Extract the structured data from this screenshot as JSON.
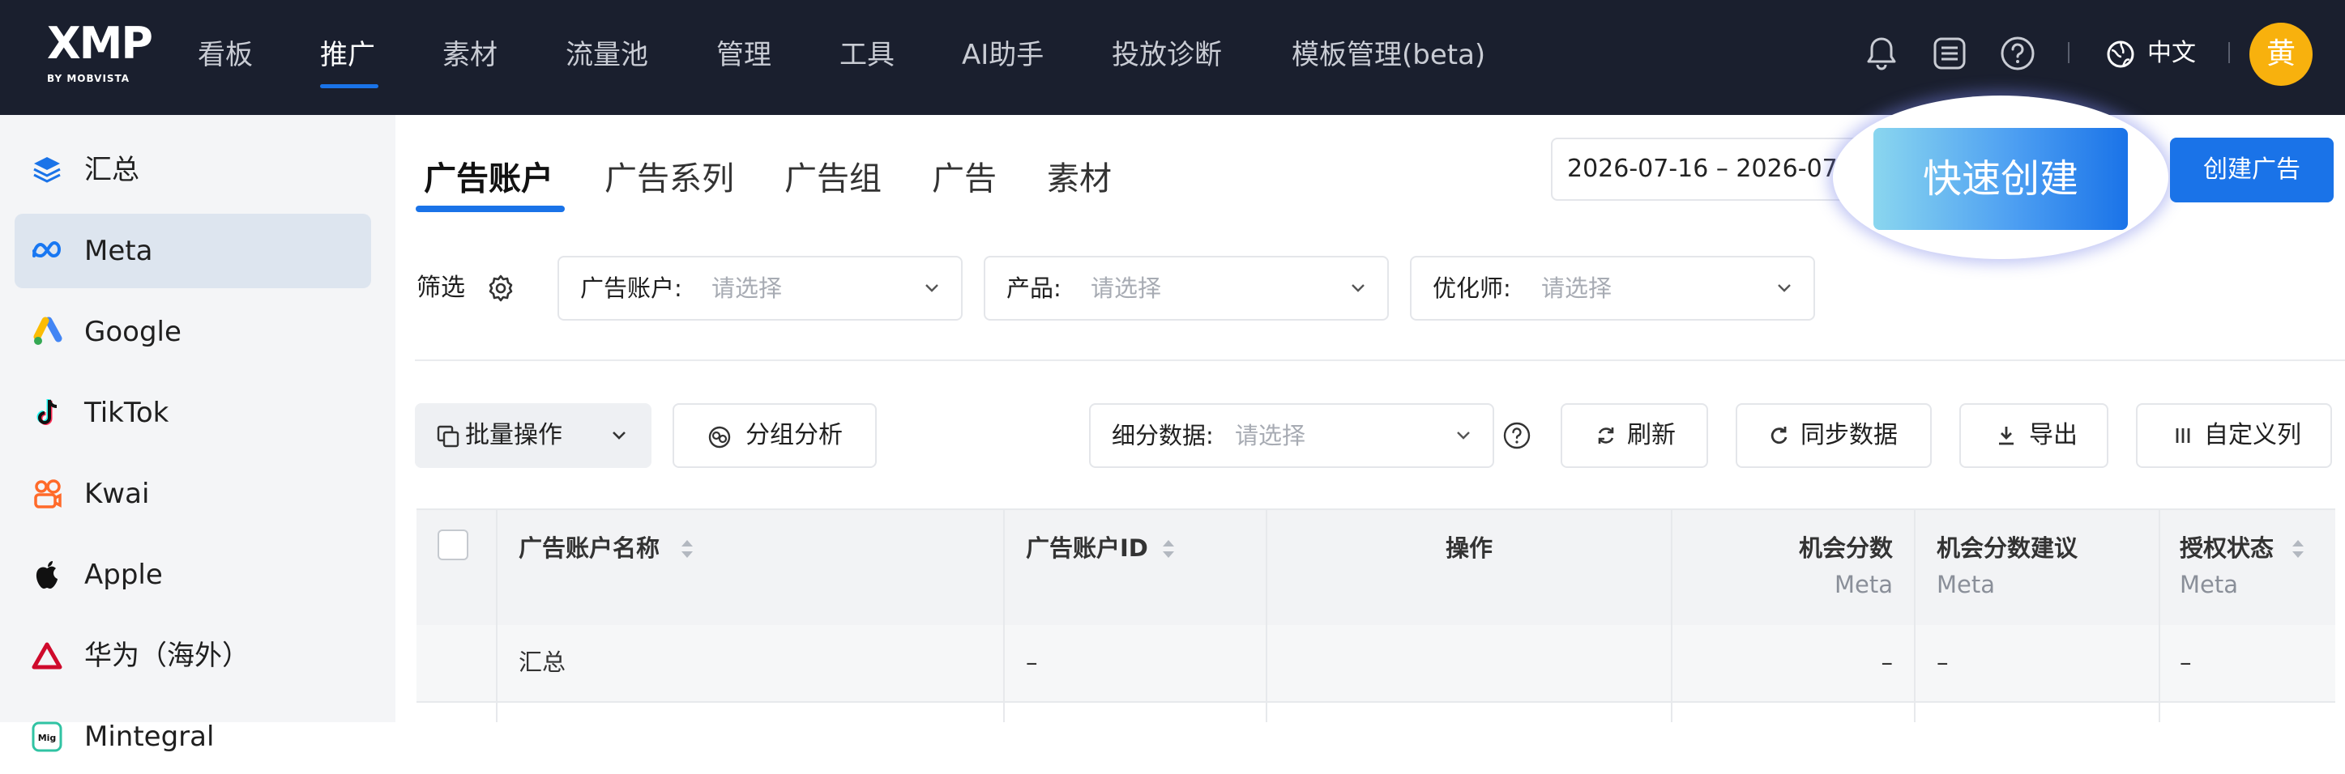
{
  "brand": {
    "logo": "XMP",
    "logo_sub": "BY MOBVISTA"
  },
  "nav": {
    "items": [
      "看板",
      "推广",
      "素材",
      "流量池",
      "管理",
      "工具",
      "AI助手",
      "投放诊断",
      "模板管理(beta)"
    ],
    "active": "推广",
    "lang": "中文",
    "avatar": "黄",
    "icons": [
      "bell-icon",
      "list-icon",
      "help-icon",
      "globe-icon"
    ]
  },
  "sidebar": {
    "items": [
      {
        "label": "汇总",
        "icon": "layers-icon"
      },
      {
        "label": "Meta",
        "icon": "meta-logo-icon",
        "active": true
      },
      {
        "label": "Google",
        "icon": "google-ads-icon"
      },
      {
        "label": "TikTok",
        "icon": "tiktok-icon"
      },
      {
        "label": "Kwai",
        "icon": "kwai-icon"
      },
      {
        "label": "Apple",
        "icon": "apple-icon"
      },
      {
        "label": "华为（海外）",
        "icon": "huawei-icon"
      },
      {
        "label": "Mintegral",
        "icon": "mintegral-icon"
      }
    ]
  },
  "tabs": [
    "广告账户",
    "广告系列",
    "广告组",
    "广告",
    "素材"
  ],
  "date_range": "2026-07-16 – 2026-07",
  "quick_create": "快速创建",
  "create_ad": "创建广告",
  "filters": {
    "label": "筛选",
    "selects": [
      {
        "label": "广告账户:",
        "placeholder": "请选择"
      },
      {
        "label": "产品:",
        "placeholder": "请选择"
      },
      {
        "label": "优化师:",
        "placeholder": "请选择"
      }
    ]
  },
  "toolbar": {
    "batch": "批量操作",
    "group_analysis": "分组分析",
    "breakdown_label": "细分数据:",
    "breakdown_placeholder": "请选择",
    "refresh": "刷新",
    "sync": "同步数据",
    "export": "导出",
    "custom_columns": "自定义列"
  },
  "table": {
    "columns": [
      {
        "title": "广告账户名称",
        "sortable": true
      },
      {
        "title": "广告账户ID",
        "sortable": true
      },
      {
        "title": "操作"
      },
      {
        "title": "机会分数",
        "sub": "Meta"
      },
      {
        "title": "机会分数建议",
        "sub": "Meta"
      },
      {
        "title": "授权状态",
        "sub": "Meta",
        "sortable": true
      }
    ],
    "summary_row": [
      "汇总",
      "–",
      "",
      "–",
      "–",
      "–"
    ]
  },
  "colors": {
    "nav_bg": "#1a1f2e",
    "accent": "#1a73e8",
    "avatar": "#f8b10d"
  }
}
